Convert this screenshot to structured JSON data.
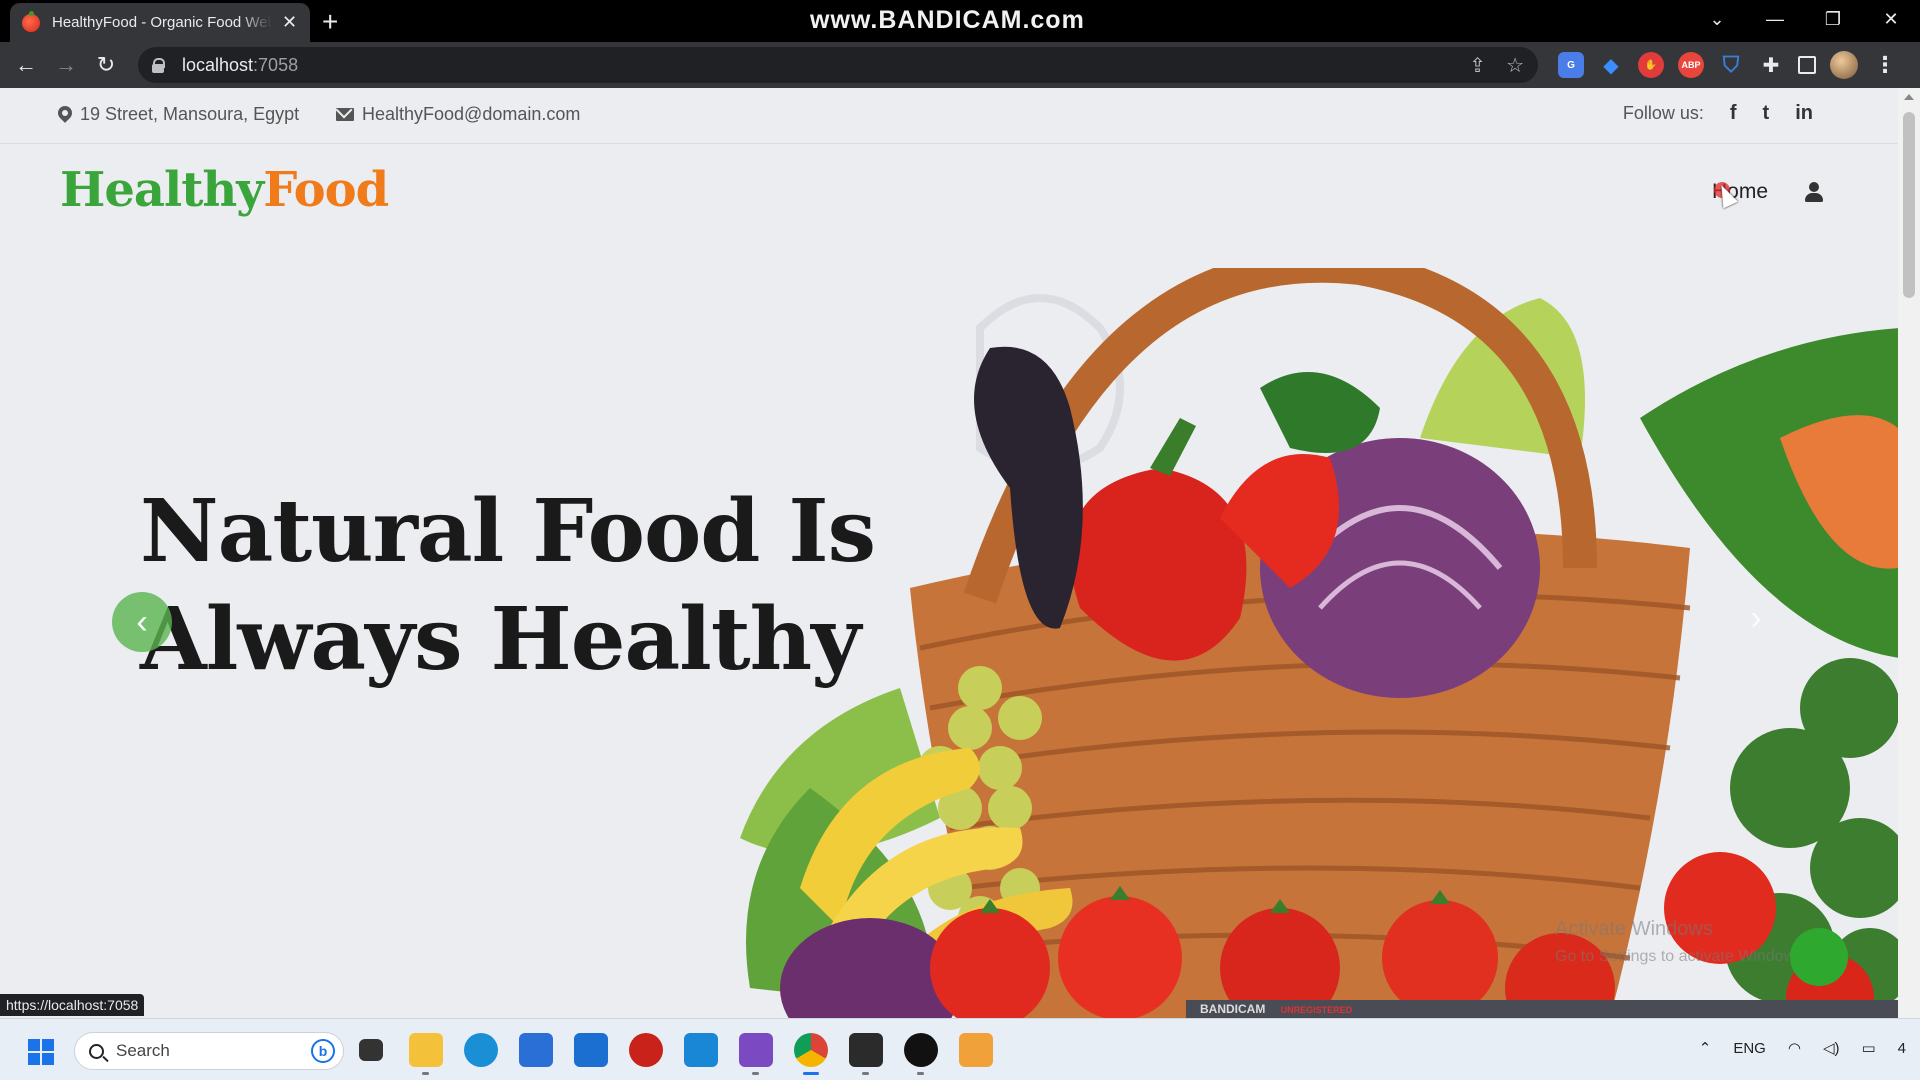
{
  "browser": {
    "tab_title": "HealthyFood - Organic Food Website",
    "url_host": "localhost",
    "url_port": ":7058",
    "status_url": "https://localhost:7058",
    "recording_banner": "www.BANDICAM.com"
  },
  "topbar": {
    "address": "19 Street, Mansoura, Egypt",
    "email": "HealthyFood@domain.com",
    "follow_label": "Follow us:",
    "social": [
      "f",
      "t",
      "in"
    ]
  },
  "header": {
    "logo_part1": "Healthy",
    "logo_part2": "Food",
    "nav_home": "Home"
  },
  "hero": {
    "line1": "Natural Food Is",
    "line2": "Always Healthy"
  },
  "watermarks": {
    "windows_line1": "Activate Windows",
    "windows_line2": "Go to Settings to activate Windows.",
    "bandicam_label": "BANDICAM",
    "bandicam_status": "UNREGISTERED"
  },
  "taskbar": {
    "search_placeholder": "Search",
    "language": "ENG",
    "notification_count": "4"
  },
  "colors": {
    "logo_green": "#3aa53a",
    "logo_orange": "#f07b1a",
    "accent_green": "#5ab450"
  }
}
